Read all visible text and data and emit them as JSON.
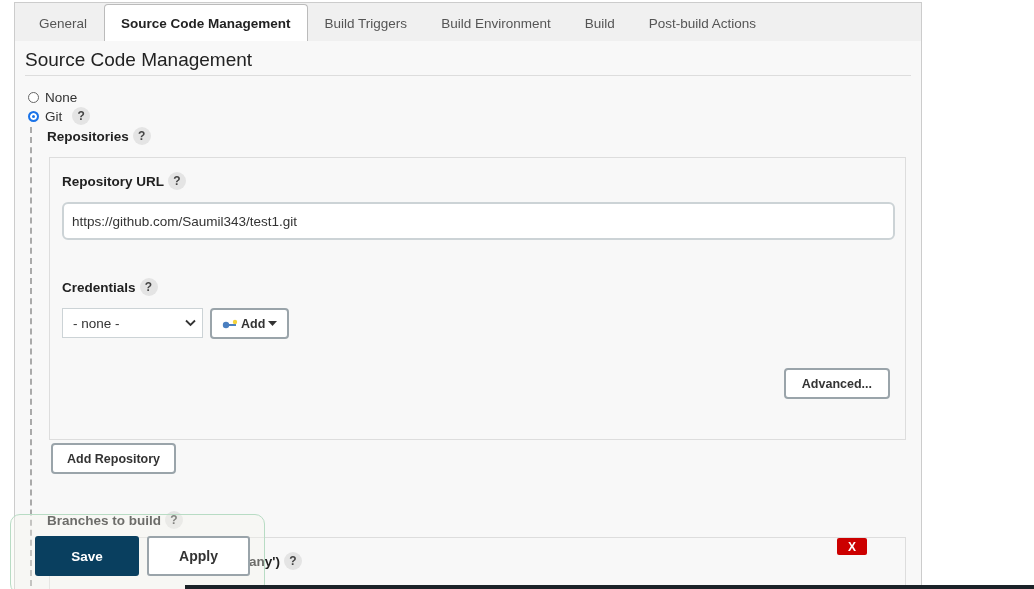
{
  "tabs": [
    {
      "label": "General",
      "selected": false
    },
    {
      "label": "Source Code Management",
      "selected": true
    },
    {
      "label": "Build Triggers",
      "selected": false
    },
    {
      "label": "Build Environment",
      "selected": false
    },
    {
      "label": "Build",
      "selected": false
    },
    {
      "label": "Post-build Actions",
      "selected": false
    }
  ],
  "section_title": "Source Code Management",
  "scm_options": [
    {
      "label": "None",
      "selected": false
    },
    {
      "label": "Git",
      "selected": true,
      "help": "?"
    }
  ],
  "repositories": {
    "label": "Repositories",
    "help": "?",
    "repository_url": {
      "label": "Repository URL",
      "help": "?",
      "value": "https://github.com/Saumil343/test1.git"
    },
    "credentials": {
      "label": "Credentials",
      "help": "?",
      "value": "- none -",
      "add_button": "Add"
    },
    "advanced_button": "Advanced...",
    "add_repository_button": "Add Repository"
  },
  "branches": {
    "label": "Branches to build",
    "help": "?",
    "specifier_label": "any')",
    "specifier_help": "?"
  },
  "actions": {
    "save": "Save",
    "apply": "Apply"
  },
  "close_button": "X"
}
